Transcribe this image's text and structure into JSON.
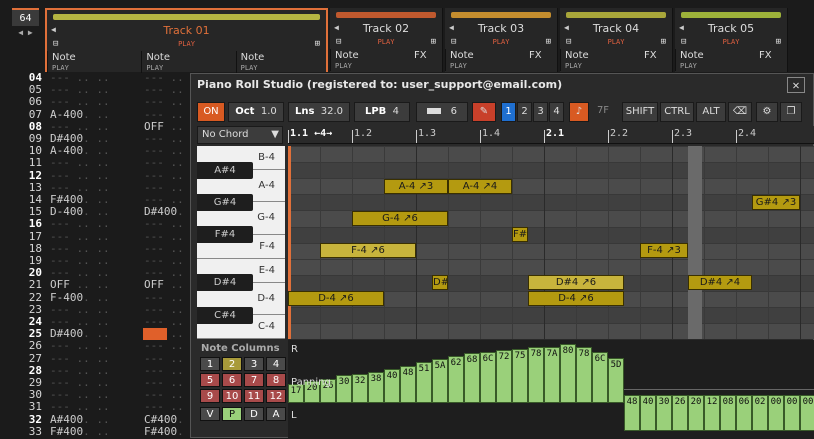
{
  "pattern_number": "64",
  "pattern_arrows": "◀ ▶",
  "tracks": [
    {
      "name": "Track 01",
      "color": "#b5b542",
      "play": "PLAY",
      "subs": [
        {
          "n": "Note",
          "p": "PLAY"
        },
        {
          "n": "Note",
          "p": "PLAY"
        },
        {
          "n": "Note",
          "p": "PLAY"
        }
      ]
    },
    {
      "name": "Track 02",
      "color": "#c0592e",
      "play": "PLAY",
      "subs": [
        {
          "n": "Note",
          "p": "PLAY",
          "fx": "FX"
        }
      ]
    },
    {
      "name": "Track 03",
      "color": "#c48d2e",
      "play": "PLAY",
      "subs": [
        {
          "n": "Note",
          "p": "PLAY",
          "fx": "FX"
        }
      ]
    },
    {
      "name": "Track 04",
      "color": "#a8a63a",
      "play": "PLAY",
      "subs": [
        {
          "n": "Note",
          "p": "PLAY",
          "fx": "FX"
        }
      ]
    },
    {
      "name": "Track 05",
      "color": "#9db23a",
      "play": "PLAY",
      "subs": [
        {
          "n": "Note",
          "p": "PLAY",
          "fx": "FX"
        }
      ]
    }
  ],
  "rows": [
    "04",
    "05",
    "06",
    "07",
    "08",
    "09",
    "10",
    "11",
    "12",
    "13",
    "14",
    "15",
    "16",
    "17",
    "18",
    "19",
    "20",
    "21",
    "22",
    "23",
    "24",
    "25",
    "26",
    "27",
    "28",
    "29",
    "30",
    "31",
    "32",
    "33"
  ],
  "cells": [
    {
      "row": "07",
      "col": 0,
      "text": "A-400"
    },
    {
      "row": "08",
      "col": 1,
      "text": "OFF"
    },
    {
      "row": "09",
      "col": 0,
      "text": "D#400"
    },
    {
      "row": "10",
      "col": 0,
      "text": "A-400"
    },
    {
      "row": "14",
      "col": 0,
      "text": "F#400"
    },
    {
      "row": "15",
      "col": 0,
      "text": "D-400"
    },
    {
      "row": "15",
      "col": 1,
      "text": "D#400"
    },
    {
      "row": "21",
      "col": 0,
      "text": "OFF"
    },
    {
      "row": "21",
      "col": 1,
      "text": "OFF"
    },
    {
      "row": "22",
      "col": 0,
      "text": "F-400"
    },
    {
      "row": "25",
      "col": 0,
      "text": "D#400"
    },
    {
      "row": "32",
      "col": 0,
      "text": "A#400"
    },
    {
      "row": "32",
      "col": 1,
      "text": "C#400"
    },
    {
      "row": "33",
      "col": 0,
      "text": "F#400"
    },
    {
      "row": "33",
      "col": 1,
      "text": "F#400"
    }
  ],
  "dialog": {
    "title": "Piano Roll Studio  (registered to: user_support@email.com)",
    "close": "✕",
    "on": "ON",
    "oct_label": "Oct",
    "oct_value": "1.0",
    "lns_label": "Lns",
    "lns_value": "32.0",
    "lpb_label": "LPB",
    "lpb_value": "4",
    "vol_value": "6",
    "nums": [
      "1",
      "2",
      "3",
      "4"
    ],
    "mute_value": "7F",
    "shift": "SHIFT",
    "ctrl": "CTRL",
    "alt": "ALT",
    "chord": "No Chord",
    "ruler": [
      "1.1 ←4→",
      "1.2",
      "1.3",
      "1.4",
      "2.1",
      "2.2",
      "2.3",
      "2.4"
    ],
    "white_keys": [
      "B-4",
      "A-4",
      "G-4",
      "F-4",
      "E-4",
      "D-4",
      "C-4"
    ],
    "black_keys": [
      "A#4",
      "G#4",
      "F#4",
      "D#4",
      "C#4"
    ],
    "notes": [
      {
        "label": "A-4 ↗3",
        "pitch": "A-4",
        "start": 3,
        "len": 2
      },
      {
        "label": "A-4 ↗4",
        "pitch": "A-4",
        "start": 5,
        "len": 2
      },
      {
        "label": "G-4 ↗6",
        "pitch": "G-4",
        "start": 2,
        "len": 3
      },
      {
        "label": "G#4 ↗3",
        "pitch": "G#4",
        "start": 14.5,
        "len": 1.5
      },
      {
        "label": "F#",
        "pitch": "F#4",
        "start": 7,
        "len": 0.5
      },
      {
        "label": "F-4 ↗6",
        "pitch": "F-4",
        "start": 1,
        "len": 3,
        "light": true
      },
      {
        "label": "F-4 ↗3",
        "pitch": "F-4",
        "start": 11,
        "len": 1.5
      },
      {
        "label": "D#",
        "pitch": "D#4",
        "start": 4.5,
        "len": 0.5
      },
      {
        "label": "D#4 ↗6",
        "pitch": "D#4",
        "start": 7.5,
        "len": 3,
        "light": true
      },
      {
        "label": "D#4 ↗4",
        "pitch": "D#4",
        "start": 12.5,
        "len": 2
      },
      {
        "label": "D-4 ↗6",
        "pitch": "D-4",
        "start": 0,
        "len": 3
      },
      {
        "label": "D-4 ↗6",
        "pitch": "D-4",
        "start": 7.5,
        "len": 3
      }
    ],
    "velocity": [
      "17",
      "20",
      "26",
      "30",
      "32",
      "38",
      "40",
      "48",
      "51",
      "5A",
      "62",
      "68",
      "6C",
      "72",
      "75",
      "78",
      "7A",
      "80",
      "78",
      "6C",
      "5D",
      "48",
      "40",
      "30",
      "26",
      "20",
      "12",
      "08",
      "06",
      "02",
      "00",
      "00",
      "00"
    ],
    "vel_labels": {
      "r": "R",
      "panning": "Panning",
      "l": "L"
    },
    "note_columns": {
      "title": "Note Columns",
      "buttons": [
        "1",
        "2",
        "3",
        "4",
        "5",
        "6",
        "7",
        "8",
        "9",
        "10",
        "11",
        "12"
      ],
      "modes": [
        "V",
        "P",
        "D",
        "A"
      ]
    }
  }
}
